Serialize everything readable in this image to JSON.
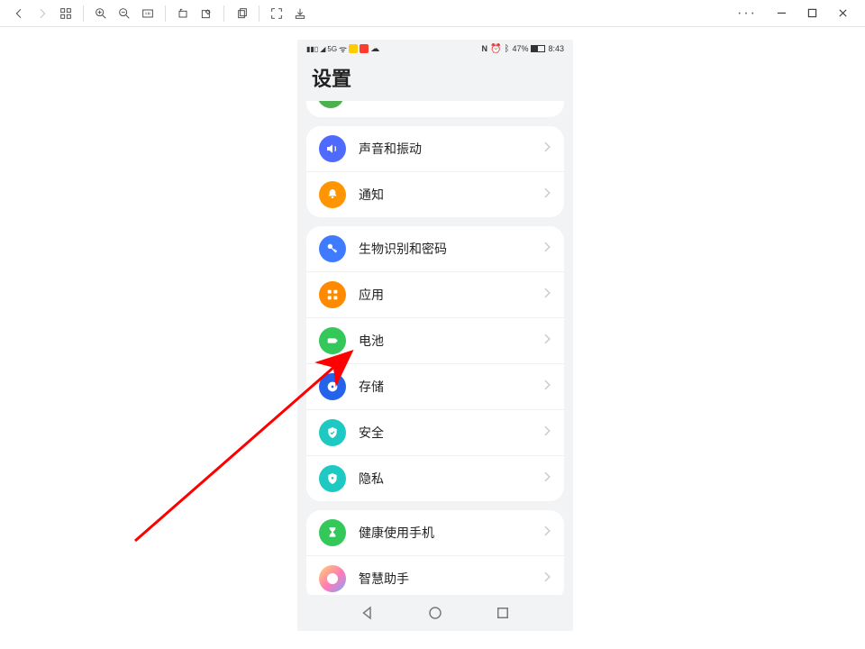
{
  "toolbar": {
    "back": "←",
    "forward": "→"
  },
  "window": {
    "more": "···"
  },
  "phone": {
    "status": {
      "battery_text": "47%",
      "time": "8:43"
    },
    "title": "设置",
    "groups": [
      {
        "items": [
          {
            "key": "sound",
            "label": "声音和振动",
            "icon": "speaker",
            "color": "c-blue"
          },
          {
            "key": "notify",
            "label": "通知",
            "icon": "bell",
            "color": "c-orange"
          }
        ]
      },
      {
        "items": [
          {
            "key": "biometric",
            "label": "生物识别和密码",
            "icon": "key",
            "color": "c-blue2"
          },
          {
            "key": "apps",
            "label": "应用",
            "icon": "grid",
            "color": "c-orange2"
          },
          {
            "key": "battery",
            "label": "电池",
            "icon": "battery",
            "color": "c-green"
          },
          {
            "key": "storage",
            "label": "存储",
            "icon": "disk",
            "color": "c-blue3"
          },
          {
            "key": "security",
            "label": "安全",
            "icon": "shield",
            "color": "c-teal"
          },
          {
            "key": "privacy",
            "label": "隐私",
            "icon": "shield2",
            "color": "c-teal2"
          }
        ]
      },
      {
        "items": [
          {
            "key": "health",
            "label": "健康使用手机",
            "icon": "hourglass",
            "color": "c-green2"
          },
          {
            "key": "assistant",
            "label": "智慧助手",
            "icon": "assistant",
            "color": "c-grad"
          }
        ]
      }
    ],
    "nav": {
      "back": "back",
      "home": "home",
      "recent": "recent"
    }
  },
  "annotation": {
    "target": "battery"
  }
}
